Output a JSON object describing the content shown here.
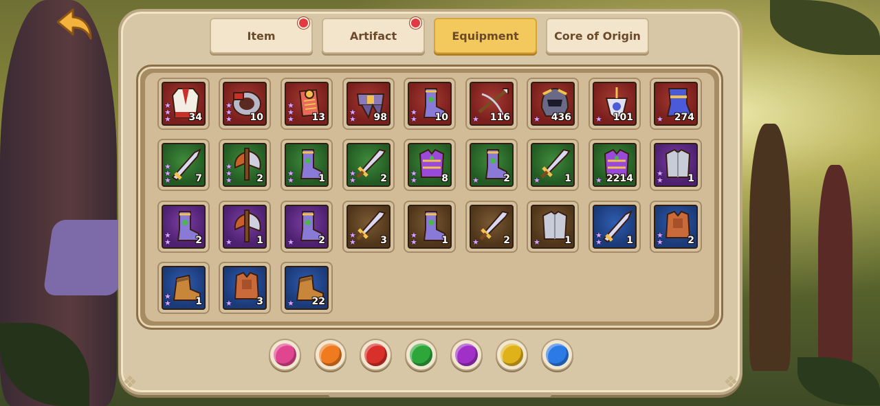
{
  "tabs": [
    {
      "label": "Item",
      "badge": true,
      "active": false
    },
    {
      "label": "Artifact",
      "badge": true,
      "active": false
    },
    {
      "label": "Equipment",
      "badge": false,
      "active": true
    },
    {
      "label": "Core of Origin",
      "badge": false,
      "active": false
    }
  ],
  "equipment": [
    {
      "icon": "robe-icon",
      "rarity": "red",
      "stars": 3,
      "count": "34"
    },
    {
      "icon": "bracer-icon",
      "rarity": "red",
      "stars": 3,
      "count": "10"
    },
    {
      "icon": "scroll-icon",
      "rarity": "red",
      "stars": 3,
      "count": "13"
    },
    {
      "icon": "belt-icon",
      "rarity": "red",
      "stars": 2,
      "count": "98"
    },
    {
      "icon": "boots-icon",
      "rarity": "red",
      "stars": 2,
      "count": "10"
    },
    {
      "icon": "crossbow-icon",
      "rarity": "red",
      "stars": 1,
      "count": "116"
    },
    {
      "icon": "helmet-icon",
      "rarity": "red",
      "stars": 1,
      "count": "436"
    },
    {
      "icon": "amulet-icon",
      "rarity": "red",
      "stars": 1,
      "count": "101"
    },
    {
      "icon": "greaves-icon",
      "rarity": "red",
      "stars": 1,
      "count": "274"
    },
    {
      "icon": "blade-icon",
      "rarity": "green",
      "stars": 3,
      "count": "7"
    },
    {
      "icon": "axe-icon",
      "rarity": "green",
      "stars": 3,
      "count": "2"
    },
    {
      "icon": "boots-icon",
      "rarity": "green",
      "stars": 2,
      "count": "1"
    },
    {
      "icon": "sword-icon",
      "rarity": "green",
      "stars": 2,
      "count": "2"
    },
    {
      "icon": "armor-icon",
      "rarity": "green",
      "stars": 2,
      "count": "8"
    },
    {
      "icon": "boots-icon",
      "rarity": "green",
      "stars": 1,
      "count": "2"
    },
    {
      "icon": "sword-icon",
      "rarity": "green",
      "stars": 1,
      "count": "1"
    },
    {
      "icon": "armor-icon",
      "rarity": "green",
      "stars": 1,
      "count": "2214"
    },
    {
      "icon": "chestplate-icon",
      "rarity": "purple",
      "stars": 2,
      "count": "1"
    },
    {
      "icon": "boots-icon",
      "rarity": "purple",
      "stars": 2,
      "count": "2"
    },
    {
      "icon": "axe-icon",
      "rarity": "purple",
      "stars": 1,
      "count": "1"
    },
    {
      "icon": "boots-icon",
      "rarity": "purple",
      "stars": 1,
      "count": "2"
    },
    {
      "icon": "sword-icon",
      "rarity": "brown",
      "stars": 2,
      "count": "3"
    },
    {
      "icon": "boots-icon",
      "rarity": "brown",
      "stars": 2,
      "count": "1"
    },
    {
      "icon": "sword-icon",
      "rarity": "brown",
      "stars": 1,
      "count": "2"
    },
    {
      "icon": "chestplate-icon",
      "rarity": "brown",
      "stars": 1,
      "count": "1"
    },
    {
      "icon": "blade-icon",
      "rarity": "blue",
      "stars": 2,
      "count": "1"
    },
    {
      "icon": "vest-icon",
      "rarity": "blue",
      "stars": 2,
      "count": "2"
    },
    {
      "icon": "shoes-icon",
      "rarity": "blue",
      "stars": 2,
      "count": "1"
    },
    {
      "icon": "vest-icon",
      "rarity": "blue",
      "stars": 1,
      "count": "3"
    },
    {
      "icon": "shoes-icon",
      "rarity": "blue",
      "stars": 1,
      "count": "22"
    }
  ],
  "filters": [
    {
      "name": "pink",
      "color": "#e0468f"
    },
    {
      "name": "orange",
      "color": "#f07a1e"
    },
    {
      "name": "red",
      "color": "#d8302a"
    },
    {
      "name": "green",
      "color": "#2ea63a"
    },
    {
      "name": "purple",
      "color": "#a030c8"
    },
    {
      "name": "yellow",
      "color": "#e0b21a"
    },
    {
      "name": "blue",
      "color": "#2b7ae6"
    }
  ]
}
